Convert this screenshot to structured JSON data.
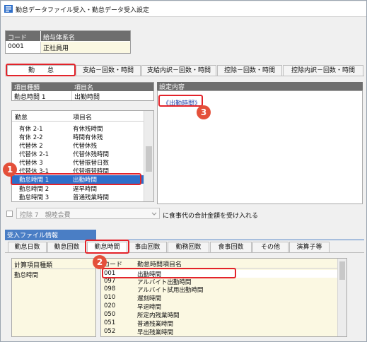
{
  "window": {
    "title": "勤怠データファイル受入・勤怠データ受入設定"
  },
  "salary_system": {
    "headers": [
      "コード",
      "給与体系名"
    ],
    "code": "0001",
    "name": "正社員用"
  },
  "top_tabs": [
    {
      "label": "勤　　怠",
      "active": true
    },
    {
      "label": "支給－回数・時間",
      "active": false
    },
    {
      "label": "支給内訳－回数・時間",
      "active": false
    },
    {
      "label": "控除－回数・時間",
      "active": false
    },
    {
      "label": "控除内訳－回数・時間",
      "active": false
    }
  ],
  "item_table": {
    "headers": [
      "項目種類",
      "項目名"
    ],
    "type": "勤怠時間 1",
    "name": "出勤時間"
  },
  "settings": {
    "header": "設定内容",
    "content": "《出勤時間》"
  },
  "kintai_list": {
    "headers": [
      "勤怠",
      "項目名"
    ],
    "rows": [
      {
        "kind": "有休 2-1",
        "name": "有休残時間",
        "selected": false
      },
      {
        "kind": "有休 2-2",
        "name": "時間有休残",
        "selected": false
      },
      {
        "kind": "代替休 2",
        "name": "代替休残",
        "selected": false
      },
      {
        "kind": "代替休 2-1",
        "name": "代替休残時間",
        "selected": false
      },
      {
        "kind": "代替休 3",
        "name": "代替振替日数",
        "selected": false
      },
      {
        "kind": "代替休 3-1",
        "name": "代替振替時間",
        "selected": false
      },
      {
        "kind": "勤怠時間 1",
        "name": "出勤時間",
        "selected": true
      },
      {
        "kind": "勤怠時間 2",
        "name": "遅早時間",
        "selected": false
      },
      {
        "kind": "勤怠時間 3",
        "name": "普通残業時間",
        "selected": false
      }
    ]
  },
  "meal_option": {
    "checked": false,
    "select_value": "控除 7　親睦会費",
    "suffix": "に食事代の合計金額を受け入れる"
  },
  "import_section": {
    "title": "受入ファイル情報",
    "tabs": [
      {
        "label": "勤怠日数",
        "active": false
      },
      {
        "label": "勤怠回数",
        "active": false
      },
      {
        "label": "勤怠時間",
        "active": true
      },
      {
        "label": "事由回数",
        "active": false
      },
      {
        "label": "勤務回数",
        "active": false
      },
      {
        "label": "食事回数",
        "active": false
      },
      {
        "label": "その他",
        "active": false
      },
      {
        "label": "演算子等",
        "active": false
      }
    ],
    "calc_list": {
      "header": "計算項目種類",
      "items": [
        "勤怠時間"
      ]
    },
    "time_list": {
      "headers": [
        "コード",
        "勤怠時間項目名"
      ],
      "rows": [
        {
          "code": "001",
          "name": "出勤時間",
          "selected": true
        },
        {
          "code": "097",
          "name": "アルバイト出勤時間",
          "selected": false
        },
        {
          "code": "098",
          "name": "アルバイト試用出勤時間",
          "selected": false
        },
        {
          "code": "010",
          "name": "遅刻時間",
          "selected": false
        },
        {
          "code": "020",
          "name": "早退時間",
          "selected": false
        },
        {
          "code": "050",
          "name": "所定内残業時間",
          "selected": false
        },
        {
          "code": "051",
          "name": "普通残業時間",
          "selected": false
        },
        {
          "code": "052",
          "name": "早出残業時間",
          "selected": false
        }
      ]
    }
  },
  "annotations": [
    "1",
    "2",
    "3"
  ],
  "colors": {
    "header_blue": "#4a7ec5",
    "header_gray": "#6e6e6e",
    "highlight_red": "#e3232a",
    "badge_red": "#e4503a",
    "selection": "#2e6fca",
    "cream": "#fbf8e2",
    "link_blue": "#1f3ea8"
  }
}
